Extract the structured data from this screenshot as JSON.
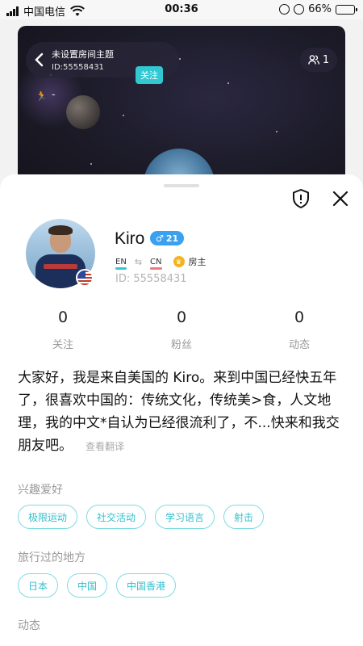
{
  "status_bar": {
    "carrier": "中国电信",
    "time": "00:36",
    "battery": "66%",
    "battery_level": 0.66
  },
  "room": {
    "title": "未设置房间主题",
    "id": "ID:55558431",
    "follow_label": "关注",
    "member_count": "1",
    "status_dash": "-"
  },
  "profile": {
    "name": "Kiro",
    "gender_symbol": "♂",
    "age": "21",
    "lang_from": "EN",
    "lang_to": "CN",
    "role": "房主",
    "id_text": "ID: 55558431",
    "stats": [
      {
        "value": "0",
        "label": "关注"
      },
      {
        "value": "0",
        "label": "粉丝"
      },
      {
        "value": "0",
        "label": "动态"
      }
    ],
    "bio": "大家好，我是来自美国的 Kiro。来到中国已经快五年了，很喜欢中国的：传统文化，传统美>食，人文地理，我的中文*自认为已经很流利了，不...快来和我交朋友吧。",
    "translate_label": "查看翻译"
  },
  "sections": {
    "hobbies_title": "兴趣爱好",
    "hobbies": [
      "极限运动",
      "社交活动",
      "学习语言",
      "射击"
    ],
    "travel_title": "旅行过的地方",
    "places": [
      "日本",
      "中国",
      "中国香港"
    ],
    "moments_title": "动态"
  },
  "colors": {
    "accent": "#33c7d6",
    "badge_blue": "#3aa0f0",
    "host_gold": "#f3b423"
  }
}
